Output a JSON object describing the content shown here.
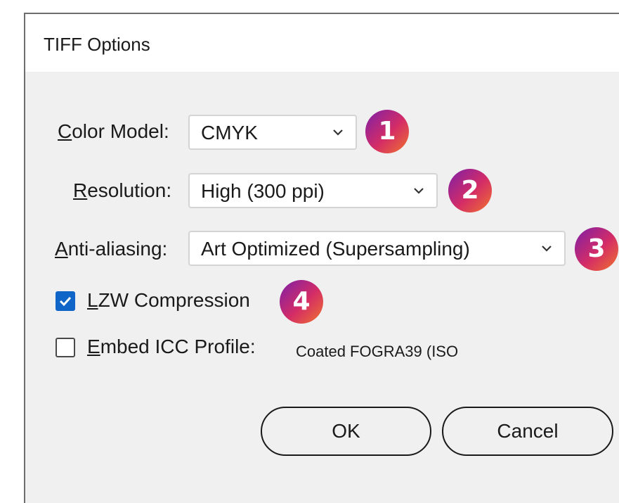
{
  "dialog": {
    "title": "TIFF Options"
  },
  "fields": {
    "color_model": {
      "label_key": "C",
      "label_rest": "olor Model:",
      "value": "CMYK",
      "badge": "1"
    },
    "resolution": {
      "label_key": "R",
      "label_rest": "esolution:",
      "value": "High (300 ppi)",
      "badge": "2"
    },
    "anti_aliasing": {
      "label_key": "A",
      "label_rest": "nti-aliasing:",
      "value": "Art Optimized (Supersampling)",
      "badge": "3"
    }
  },
  "options": {
    "lzw": {
      "label_key": "L",
      "label_rest": "ZW Compression",
      "checked": true,
      "badge": "4"
    },
    "icc": {
      "label_key": "E",
      "label_rest": "mbed ICC Profile:",
      "checked": false,
      "profile": "Coated FOGRA39 (ISO"
    }
  },
  "buttons": {
    "ok": "OK",
    "cancel": "Cancel"
  },
  "colors": {
    "accent": "#0f65c8",
    "badge_start": "#7d1fa8",
    "badge_end": "#f1742b"
  }
}
